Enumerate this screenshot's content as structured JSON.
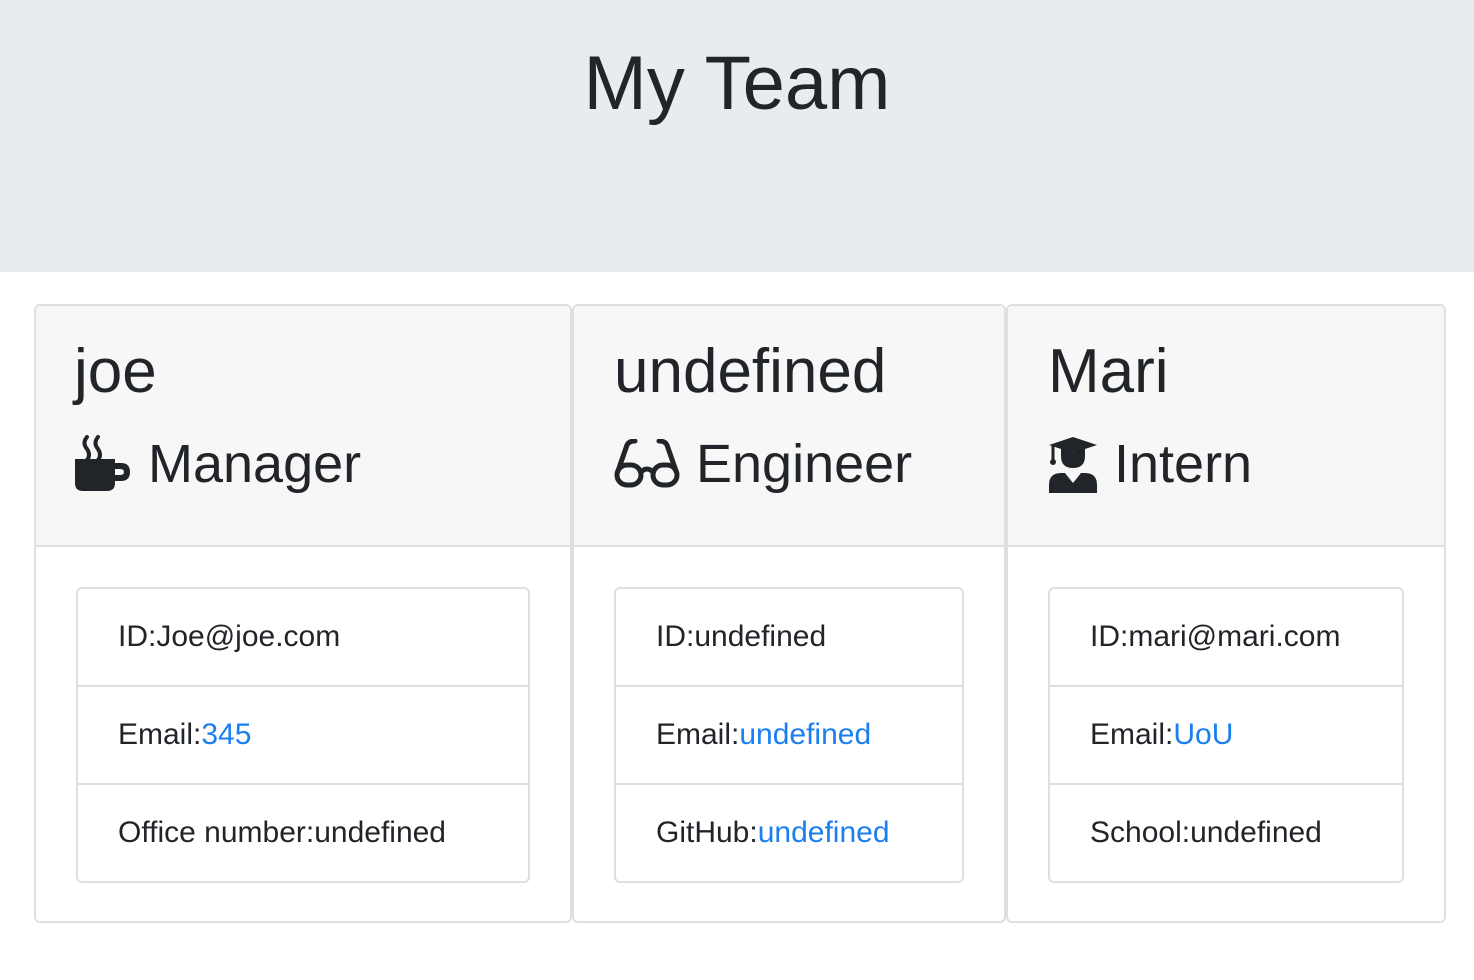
{
  "header": {
    "title": "My Team"
  },
  "theme": {
    "link_color": "#1a7ff0",
    "header_bg": "#e9ecef",
    "card_header_bg": "#f7f7f7"
  },
  "cards": [
    {
      "name": "joe",
      "role": "Manager",
      "role_icon": "coffee-mug-icon",
      "rows": [
        {
          "label": "ID: ",
          "value": "Joe@joe.com"
        },
        {
          "label": "Email: ",
          "value": "345"
        },
        {
          "label": "Office number: ",
          "value": "undefined"
        }
      ]
    },
    {
      "name": "undefined",
      "role": "Engineer",
      "role_icon": "glasses-icon",
      "rows": [
        {
          "label": "ID: ",
          "value": "undefined"
        },
        {
          "label": "Email: ",
          "value": "undefined"
        },
        {
          "label": "GitHub: ",
          "value": "undefined"
        }
      ]
    },
    {
      "name": "Mari",
      "role": "Intern",
      "role_icon": "graduate-icon",
      "rows": [
        {
          "label": "ID: ",
          "value": "mari@mari.com"
        },
        {
          "label": "Email: ",
          "value": "UoU"
        },
        {
          "label": "School: ",
          "value": "undefined"
        }
      ]
    }
  ]
}
